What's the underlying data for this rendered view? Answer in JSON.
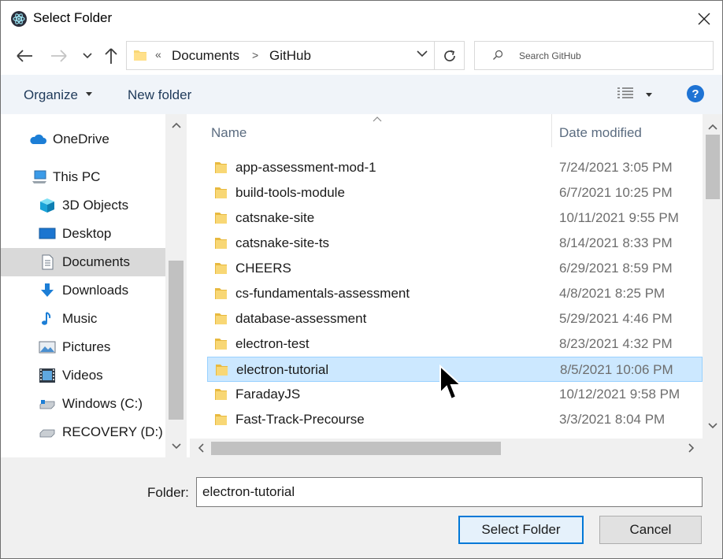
{
  "window": {
    "title": "Select Folder"
  },
  "address": {
    "root_chevron": "«",
    "crumbs": [
      "Documents",
      "GitHub"
    ],
    "separator": ">"
  },
  "search": {
    "placeholder": "Search GitHub"
  },
  "toolbar": {
    "organize_label": "Organize",
    "new_folder_label": "New folder",
    "help_label": "?"
  },
  "navigation": {
    "items": [
      {
        "label": "OneDrive",
        "icon": "cloud-icon"
      },
      {
        "label": "This PC",
        "icon": "computer-icon"
      },
      {
        "label": "3D Objects",
        "icon": "cube-icon"
      },
      {
        "label": "Desktop",
        "icon": "desktop-icon"
      },
      {
        "label": "Documents",
        "icon": "documents-icon",
        "selected": true
      },
      {
        "label": "Downloads",
        "icon": "download-arrow-icon"
      },
      {
        "label": "Music",
        "icon": "music-note-icon"
      },
      {
        "label": "Pictures",
        "icon": "pictures-icon"
      },
      {
        "label": "Videos",
        "icon": "film-icon"
      },
      {
        "label": "Windows (C:)",
        "icon": "drive-icon"
      },
      {
        "label": "RECOVERY (D:)",
        "icon": "drive-icon"
      }
    ]
  },
  "file_list": {
    "columns": {
      "name": "Name",
      "date_modified": "Date modified"
    },
    "rows": [
      {
        "name": "app-assessment-mod-1",
        "date": "7/24/2021 3:05 PM"
      },
      {
        "name": "build-tools-module",
        "date": "6/7/2021 10:25 PM"
      },
      {
        "name": "catsnake-site",
        "date": "10/11/2021 9:55 PM"
      },
      {
        "name": "catsnake-site-ts",
        "date": "8/14/2021 8:33 PM"
      },
      {
        "name": "CHEERS",
        "date": "6/29/2021 8:59 PM"
      },
      {
        "name": "cs-fundamentals-assessment",
        "date": "4/8/2021 8:25 PM"
      },
      {
        "name": "database-assessment",
        "date": "5/29/2021 4:46 PM"
      },
      {
        "name": "electron-test",
        "date": "8/23/2021 4:32 PM"
      },
      {
        "name": "electron-tutorial",
        "date": "8/5/2021 10:06 PM",
        "selected": true
      },
      {
        "name": "FaradayJS",
        "date": "10/12/2021 9:58 PM"
      },
      {
        "name": "Fast-Track-Precourse",
        "date": "3/3/2021 8:04 PM"
      }
    ]
  },
  "footer": {
    "folder_label": "Folder:",
    "folder_value": "electron-tutorial",
    "select_button": "Select Folder",
    "cancel_button": "Cancel"
  },
  "colors": {
    "accent": "#0078d7",
    "selection": "#cce8ff",
    "folder": "#f8d775",
    "toolbar_bg": "#f0f4f9"
  }
}
